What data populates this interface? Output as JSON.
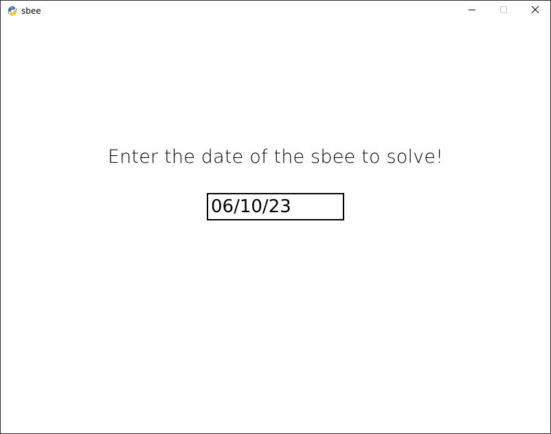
{
  "window": {
    "title": "sbee",
    "app_icon": "pygame-snake-icon",
    "controls": {
      "minimize_icon": "minimize-icon",
      "maximize_icon": "maximize-icon",
      "close_icon": "close-icon"
    }
  },
  "main": {
    "prompt": "Enter the date of the sbee to solve!",
    "date_input": {
      "value": "06/10/23"
    }
  },
  "colors": {
    "background": "#ffffff",
    "text": "#000000",
    "input_border": "#000000"
  }
}
